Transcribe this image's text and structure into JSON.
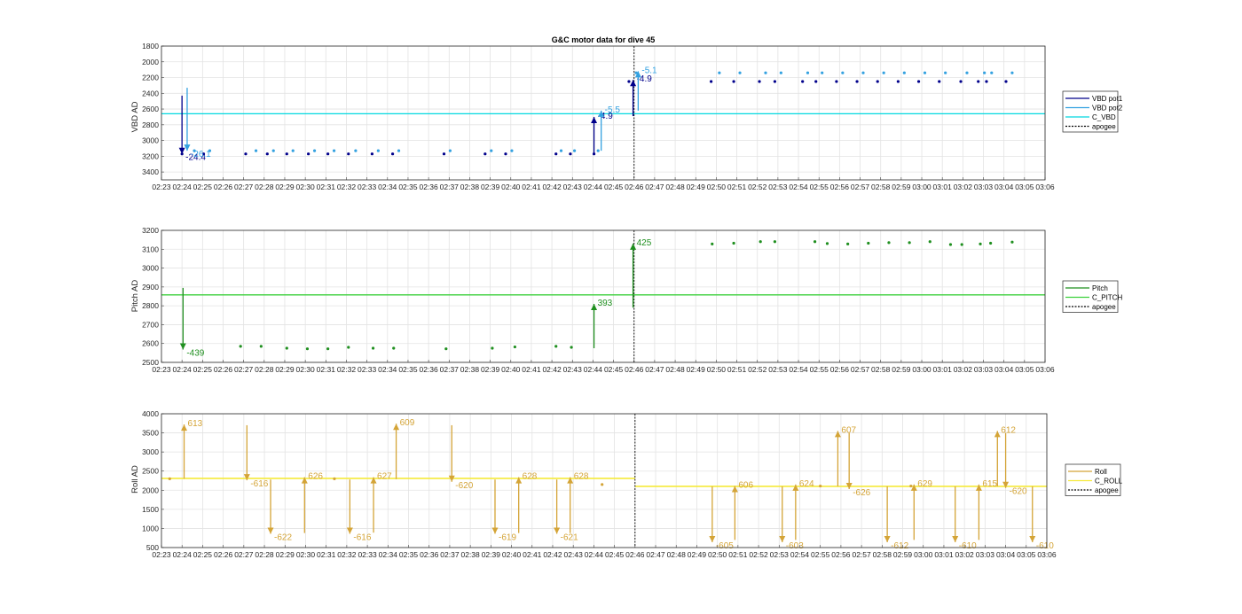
{
  "chart_data": [
    {
      "type": "line",
      "title": "G&C motor data for dive 45",
      "ylabel": "VBD AD",
      "ylim": [
        1800,
        3500
      ],
      "y_reversed": true,
      "yticks": [
        1800,
        2000,
        2200,
        2400,
        2600,
        2800,
        3000,
        3200,
        3400
      ],
      "x_ticks": [
        "02:23",
        "02:24",
        "02:25",
        "02:26",
        "02:27",
        "02:28",
        "02:29",
        "02:30",
        "02:31",
        "02:32",
        "02:33",
        "02:34",
        "02:35",
        "02:36",
        "02:37",
        "02:38",
        "02:39",
        "02:40",
        "02:41",
        "02:42",
        "02:43",
        "02:44",
        "02:45",
        "02:46",
        "02:47",
        "02:48",
        "02:49",
        "02:50",
        "02:51",
        "02:52",
        "02:53",
        "02:54",
        "02:55",
        "02:56",
        "02:57",
        "02:58",
        "02:59",
        "03:00",
        "03:01",
        "03:02",
        "03:03",
        "03:04",
        "03:05",
        "03:06"
      ],
      "grid": true,
      "legend_position": "outside-right",
      "apogee_x": 23.0,
      "series": [
        {
          "name": "VBD pot1",
          "color": "#00008B",
          "dot_x": [
            1.0,
            2.05,
            4.1,
            5.15,
            6.1,
            7.15,
            8.1,
            9.1,
            10.25,
            11.25,
            13.75,
            15.75,
            16.75,
            19.2,
            19.9,
            21.05,
            22.75,
            26.75,
            27.85,
            29.1,
            29.85,
            31.2,
            31.85,
            32.85,
            33.85,
            34.85,
            35.85,
            36.85,
            37.85,
            38.9,
            39.75,
            40.15,
            41.1
          ],
          "dot_y": [
            3170,
            3170,
            3170,
            3170,
            3170,
            3170,
            3170,
            3170,
            3170,
            3170,
            3170,
            3170,
            3170,
            3170,
            3170,
            3170,
            2250,
            2250,
            2250,
            2250,
            2250,
            2250,
            2250,
            2250,
            2250,
            2250,
            2250,
            2250,
            2250,
            2250,
            2250,
            2250,
            2250
          ]
        },
        {
          "name": "VBD pot2",
          "color": "#33A1E0",
          "dot_x": [
            1.6,
            2.35,
            4.6,
            5.45,
            6.4,
            7.45,
            8.4,
            9.45,
            10.55,
            11.55,
            14.05,
            16.05,
            17.05,
            19.45,
            20.1,
            21.25,
            23.1,
            27.15,
            28.15,
            29.4,
            30.15,
            31.45,
            32.15,
            33.15,
            34.15,
            35.15,
            36.15,
            37.15,
            38.15,
            39.2,
            40.05,
            40.4,
            41.4
          ],
          "dot_y": [
            3130,
            3130,
            3130,
            3130,
            3130,
            3130,
            3130,
            3130,
            3130,
            3130,
            3130,
            3130,
            3130,
            3130,
            3130,
            3130,
            2140,
            2140,
            2140,
            2140,
            2140,
            2140,
            2140,
            2140,
            2140,
            2140,
            2140,
            2140,
            2140,
            2140,
            2140,
            2140,
            2140
          ]
        },
        {
          "name": "C_VBD",
          "color": "#00D8E0",
          "y": 2660
        },
        {
          "name": "apogee",
          "color": "#000000",
          "dashed": true
        }
      ],
      "annotations": [
        {
          "text": "-24.4",
          "color": "#00008B",
          "x": 1.0,
          "y_from": 2430,
          "y_to": 3170
        },
        {
          "text": "-26.1",
          "color": "#33A1E0",
          "x": 1.25,
          "y_from": 2330,
          "y_to": 3130
        },
        {
          "text": "-4.9",
          "color": "#00008B",
          "x": 21.05,
          "y_from": 3170,
          "y_to": 2700
        },
        {
          "text": "-5.5",
          "color": "#33A1E0",
          "x": 21.4,
          "y_from": 3130,
          "y_to": 2620
        },
        {
          "text": "-4.9",
          "color": "#00008B",
          "x": 22.95,
          "y_from": 2690,
          "y_to": 2230
        },
        {
          "text": "-5.1",
          "color": "#33A1E0",
          "x": 23.2,
          "y_from": 2620,
          "y_to": 2120
        }
      ]
    },
    {
      "type": "line",
      "ylabel": "Pitch AD",
      "ylim": [
        2500,
        3200
      ],
      "yticks": [
        2500,
        2600,
        2700,
        2800,
        2900,
        3000,
        3100,
        3200
      ],
      "x_ticks": [
        "02:23",
        "02:24",
        "02:25",
        "02:26",
        "02:27",
        "02:28",
        "02:29",
        "02:30",
        "02:31",
        "02:32",
        "02:33",
        "02:34",
        "02:35",
        "02:36",
        "02:37",
        "02:38",
        "02:39",
        "02:40",
        "02:41",
        "02:42",
        "02:43",
        "02:44",
        "02:45",
        "02:46",
        "02:47",
        "02:48",
        "02:49",
        "02:50",
        "02:51",
        "02:52",
        "02:53",
        "02:54",
        "02:55",
        "02:56",
        "02:57",
        "02:58",
        "02:59",
        "03:00",
        "03:01",
        "03:02",
        "03:03",
        "03:04",
        "03:05",
        "03:06"
      ],
      "grid": true,
      "legend_position": "outside-right",
      "apogee_x": 23.0,
      "series": [
        {
          "name": "Pitch",
          "color": "#1F8F1F",
          "dot_x": [
            3.85,
            4.85,
            6.1,
            7.1,
            8.1,
            9.1,
            10.3,
            11.3,
            13.85,
            16.1,
            17.2,
            19.2,
            19.95,
            26.8,
            27.85,
            29.15,
            29.85,
            31.8,
            32.4,
            33.4,
            34.4,
            35.4,
            36.4,
            37.4,
            38.4,
            38.95,
            39.85,
            40.35,
            41.4
          ],
          "dot_y": [
            2585,
            2585,
            2575,
            2572,
            2572,
            2580,
            2575,
            2575,
            2572,
            2575,
            2582,
            2585,
            2580,
            3128,
            3132,
            3140,
            3140,
            3140,
            3130,
            3128,
            3132,
            3135,
            3135,
            3140,
            3125,
            3125,
            3128,
            3132,
            3138
          ]
        },
        {
          "name": "C_PITCH",
          "color": "#3CD13C",
          "y": 2858
        },
        {
          "name": "apogee",
          "color": "#000000",
          "dashed": true
        }
      ],
      "annotations": [
        {
          "text": "-439",
          "color": "#1F8F1F",
          "x": 1.05,
          "y_from": 2895,
          "y_to": 2568
        },
        {
          "text": "393",
          "color": "#1F8F1F",
          "x": 21.05,
          "y_from": 2575,
          "y_to": 2810
        },
        {
          "text": "425",
          "color": "#1F8F1F",
          "x": 22.95,
          "y_from": 2790,
          "y_to": 3130
        }
      ]
    },
    {
      "type": "line",
      "ylabel": "Roll AD",
      "ylim": [
        500,
        4000
      ],
      "yticks": [
        500,
        1000,
        1500,
        2000,
        2500,
        3000,
        3500,
        4000
      ],
      "x_ticks": [
        "02:23",
        "02:24",
        "02:25",
        "02:26",
        "02:27",
        "02:28",
        "02:29",
        "02:30",
        "02:31",
        "02:32",
        "02:33",
        "02:34",
        "02:35",
        "02:36",
        "02:37",
        "02:38",
        "02:39",
        "02:40",
        "02:41",
        "02:42",
        "02:43",
        "02:44",
        "02:45",
        "02:46",
        "02:47",
        "02:48",
        "02:49",
        "02:50",
        "02:51",
        "02:52",
        "02:53",
        "02:54",
        "02:55",
        "02:56",
        "02:57",
        "02:58",
        "02:59",
        "03:00",
        "03:01",
        "03:02",
        "03:03",
        "03:04",
        "03:05",
        "03:06"
      ],
      "grid": true,
      "legend_position": "outside-right",
      "apogee_x": 23.0,
      "series": [
        {
          "name": "Roll",
          "color": "#D4A437",
          "dot_x": [
            0.4,
            8.4,
            21.4,
            32.0,
            36.4
          ],
          "dot_y": [
            2300,
            2300,
            2150,
            2110,
            2110
          ]
        },
        {
          "name": "C_ROLL",
          "color": "#F5EA3A",
          "y_before_apogee": 2310,
          "y_after_apogee": 2100
        },
        {
          "name": "apogee",
          "color": "#000000",
          "dashed": true
        }
      ],
      "annotations": [
        {
          "text": "613",
          "color": "#D4A437",
          "x": 1.1,
          "y_from": 2300,
          "y_to": 3720
        },
        {
          "text": "-616",
          "color": "#D4A437",
          "x": 4.15,
          "y_from": 3700,
          "y_to": 2260
        },
        {
          "text": "-622",
          "color": "#D4A437",
          "x": 5.3,
          "y_from": 2280,
          "y_to": 860
        },
        {
          "text": "626",
          "color": "#D4A437",
          "x": 6.95,
          "y_from": 880,
          "y_to": 2340
        },
        {
          "text": "-616",
          "color": "#D4A437",
          "x": 9.15,
          "y_from": 2280,
          "y_to": 860
        },
        {
          "text": "627",
          "color": "#D4A437",
          "x": 10.3,
          "y_from": 890,
          "y_to": 2340
        },
        {
          "text": "609",
          "color": "#D4A437",
          "x": 11.4,
          "y_from": 2290,
          "y_to": 3740
        },
        {
          "text": "-620",
          "color": "#D4A437",
          "x": 14.1,
          "y_from": 3700,
          "y_to": 2220
        },
        {
          "text": "-619",
          "color": "#D4A437",
          "x": 16.2,
          "y_from": 2280,
          "y_to": 860
        },
        {
          "text": "628",
          "color": "#D4A437",
          "x": 17.35,
          "y_from": 880,
          "y_to": 2340
        },
        {
          "text": "-621",
          "color": "#D4A437",
          "x": 19.2,
          "y_from": 2280,
          "y_to": 860
        },
        {
          "text": "628",
          "color": "#D4A437",
          "x": 19.85,
          "y_from": 880,
          "y_to": 2340
        },
        {
          "text": "-605",
          "color": "#D4A437",
          "x": 26.75,
          "y_from": 2100,
          "y_to": 640
        },
        {
          "text": "606",
          "color": "#D4A437",
          "x": 27.85,
          "y_from": 700,
          "y_to": 2110
        },
        {
          "text": "-603",
          "color": "#D4A437",
          "x": 30.15,
          "y_from": 2100,
          "y_to": 640
        },
        {
          "text": "624",
          "color": "#D4A437",
          "x": 30.8,
          "y_from": 700,
          "y_to": 2150
        },
        {
          "text": "607",
          "color": "#D4A437",
          "x": 32.85,
          "y_from": 2100,
          "y_to": 3550
        },
        {
          "text": "-626",
          "color": "#D4A437",
          "x": 33.4,
          "y_from": 3500,
          "y_to": 2030
        },
        {
          "text": "-612",
          "color": "#D4A437",
          "x": 35.25,
          "y_from": 2100,
          "y_to": 640
        },
        {
          "text": "629",
          "color": "#D4A437",
          "x": 36.55,
          "y_from": 700,
          "y_to": 2150
        },
        {
          "text": "-610",
          "color": "#D4A437",
          "x": 38.55,
          "y_from": 2100,
          "y_to": 640
        },
        {
          "text": "615",
          "color": "#D4A437",
          "x": 39.7,
          "y_from": 700,
          "y_to": 2150
        },
        {
          "text": "612",
          "color": "#D4A437",
          "x": 40.6,
          "y_from": 2100,
          "y_to": 3550
        },
        {
          "text": "-620",
          "color": "#D4A437",
          "x": 41.0,
          "y_from": 3500,
          "y_to": 2060
        },
        {
          "text": "-610",
          "color": "#D4A437",
          "x": 42.3,
          "y_from": 2100,
          "y_to": 640
        }
      ]
    }
  ]
}
